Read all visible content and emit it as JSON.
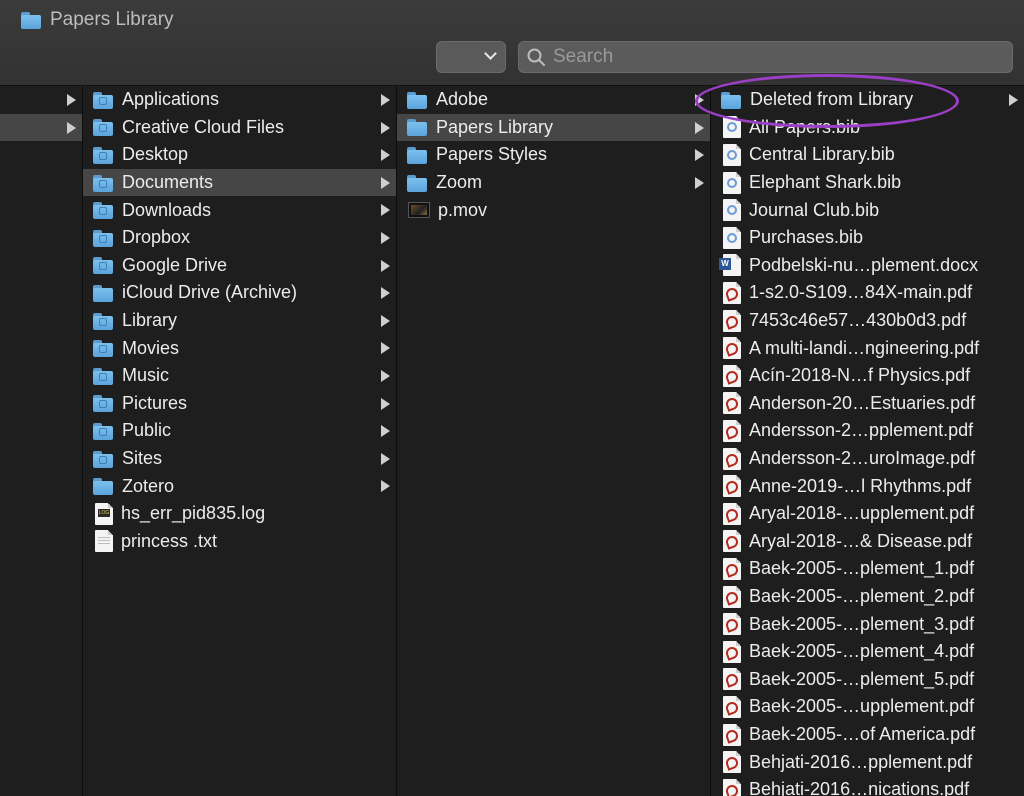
{
  "window": {
    "title": "Papers Library"
  },
  "toolbar": {
    "search_placeholder": "Search"
  },
  "colors": {
    "folder": "#6eb5e8",
    "annotation": "#9b3fc6",
    "selection": "#464646"
  },
  "column1": {
    "items": [
      {
        "label": "",
        "icon": "none",
        "has_children": true
      },
      {
        "label": "",
        "icon": "none",
        "has_children": true,
        "selected": true
      }
    ]
  },
  "column2": {
    "items": [
      {
        "label": "Applications",
        "icon": "folder-applications-icon",
        "has_children": true
      },
      {
        "label": "Creative Cloud Files",
        "icon": "folder-cloud-icon",
        "has_children": true
      },
      {
        "label": "Desktop",
        "icon": "folder-desktop-icon",
        "has_children": true
      },
      {
        "label": "Documents",
        "icon": "folder-documents-icon",
        "has_children": true,
        "selected": true
      },
      {
        "label": "Downloads",
        "icon": "folder-downloads-icon",
        "has_children": true
      },
      {
        "label": "Dropbox",
        "icon": "folder-dropbox-icon",
        "has_children": true
      },
      {
        "label": "Google Drive",
        "icon": "folder-drive-icon",
        "has_children": true
      },
      {
        "label": "iCloud Drive (Archive)",
        "icon": "folder-icon",
        "has_children": true
      },
      {
        "label": "Library",
        "icon": "folder-library-icon",
        "has_children": true
      },
      {
        "label": "Movies",
        "icon": "folder-movies-icon",
        "has_children": true
      },
      {
        "label": "Music",
        "icon": "folder-music-icon",
        "has_children": true
      },
      {
        "label": "Pictures",
        "icon": "folder-pictures-icon",
        "has_children": true
      },
      {
        "label": "Public",
        "icon": "folder-public-icon",
        "has_children": true
      },
      {
        "label": "Sites",
        "icon": "folder-sites-icon",
        "has_children": true
      },
      {
        "label": "Zotero",
        "icon": "folder-icon",
        "has_children": true
      },
      {
        "label": "hs_err_pid835.log",
        "icon": "log-file-icon",
        "has_children": false
      },
      {
        "label": "princess .txt",
        "icon": "text-file-icon",
        "has_children": false
      }
    ]
  },
  "column3": {
    "items": [
      {
        "label": "Adobe",
        "icon": "folder-icon",
        "has_children": true
      },
      {
        "label": "Papers Library",
        "icon": "folder-icon",
        "has_children": true,
        "selected": true
      },
      {
        "label": "Papers Styles",
        "icon": "folder-icon",
        "has_children": true
      },
      {
        "label": "Zoom",
        "icon": "folder-icon",
        "has_children": true
      },
      {
        "label": "p.mov",
        "icon": "movie-file-icon",
        "has_children": false
      }
    ]
  },
  "column4": {
    "items": [
      {
        "label": "Deleted from Library",
        "icon": "folder-icon",
        "has_children": true
      },
      {
        "label": "All Papers.bib",
        "icon": "bib-file-icon",
        "has_children": false
      },
      {
        "label": "Central Library.bib",
        "icon": "bib-file-icon",
        "has_children": false
      },
      {
        "label": "Elephant Shark.bib",
        "icon": "bib-file-icon",
        "has_children": false
      },
      {
        "label": "Journal Club.bib",
        "icon": "bib-file-icon",
        "has_children": false
      },
      {
        "label": "Purchases.bib",
        "icon": "bib-file-icon",
        "has_children": false
      },
      {
        "label": "Podbelski-nu…plement.docx",
        "icon": "word-file-icon",
        "has_children": false
      },
      {
        "label": "1-s2.0-S109…84X-main.pdf",
        "icon": "pdf-file-icon",
        "has_children": false
      },
      {
        "label": "7453c46e57…430b0d3.pdf",
        "icon": "pdf-file-icon",
        "has_children": false
      },
      {
        "label": "A multi-landi…ngineering.pdf",
        "icon": "pdf-file-icon",
        "has_children": false
      },
      {
        "label": "Acín-2018-N…f Physics.pdf",
        "icon": "pdf-file-icon",
        "has_children": false
      },
      {
        "label": "Anderson-20…Estuaries.pdf",
        "icon": "pdf-file-icon",
        "has_children": false
      },
      {
        "label": "Andersson-2…pplement.pdf",
        "icon": "pdf-file-icon",
        "has_children": false
      },
      {
        "label": "Andersson-2…uroImage.pdf",
        "icon": "pdf-file-icon",
        "has_children": false
      },
      {
        "label": "Anne-2019-…l Rhythms.pdf",
        "icon": "pdf-file-icon",
        "has_children": false
      },
      {
        "label": "Aryal-2018-…upplement.pdf",
        "icon": "pdf-file-icon",
        "has_children": false
      },
      {
        "label": "Aryal-2018-…& Disease.pdf",
        "icon": "pdf-file-icon",
        "has_children": false
      },
      {
        "label": "Baek-2005-…plement_1.pdf",
        "icon": "pdf-file-icon",
        "has_children": false
      },
      {
        "label": "Baek-2005-…plement_2.pdf",
        "icon": "pdf-file-icon",
        "has_children": false
      },
      {
        "label": "Baek-2005-…plement_3.pdf",
        "icon": "pdf-file-icon",
        "has_children": false
      },
      {
        "label": "Baek-2005-…plement_4.pdf",
        "icon": "pdf-file-icon",
        "has_children": false
      },
      {
        "label": "Baek-2005-…plement_5.pdf",
        "icon": "pdf-file-icon",
        "has_children": false
      },
      {
        "label": "Baek-2005-…upplement.pdf",
        "icon": "pdf-file-icon",
        "has_children": false
      },
      {
        "label": "Baek-2005-…of America.pdf",
        "icon": "pdf-file-icon",
        "has_children": false
      },
      {
        "label": "Behjati-2016…pplement.pdf",
        "icon": "pdf-file-icon",
        "has_children": false
      },
      {
        "label": "Behjati-2016…nications.pdf",
        "icon": "pdf-file-icon",
        "has_children": false
      }
    ]
  }
}
